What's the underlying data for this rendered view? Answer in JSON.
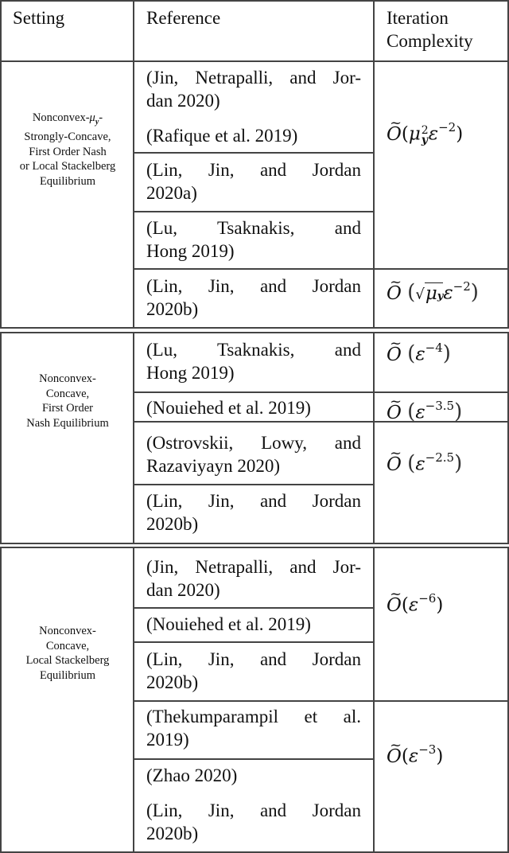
{
  "header": {
    "setting": "Setting",
    "reference": "Reference",
    "complexity_line1": "Iteration",
    "complexity_line2": "Complexity"
  },
  "sections": [
    {
      "setting_lines": [
        "Nonconvex-μ_y-",
        "Strongly-Concave,",
        "First Order Nash",
        "or Local Stackelberg",
        "Equilibrium"
      ],
      "setting_prefix": "Nonconvex-",
      "setting_mu": "μ",
      "setting_mu_sub": "y",
      "setting_rest": [
        "Strongly-Concave,",
        "First Order Nash",
        "or Local Stackelberg",
        "Equilibrium"
      ],
      "references": [
        {
          "line1": "(Jin, Netrapalli, and Jor-",
          "line2": "dan 2020)"
        },
        {
          "line1": "(Rafique et al. 2019)"
        },
        {
          "line1": "(Lin, Jin, and Jordan",
          "line2": "2020a)"
        },
        {
          "line1": "(Lu, Tsaknakis, and",
          "line2": "Hong 2019)"
        },
        {
          "line1": "(Lin, Jin, and Jordan",
          "line2": "2020b)"
        }
      ],
      "complexities": [
        {
          "text": "Õ(μ_y² ε^−2)",
          "base": "O",
          "mu": "μ",
          "mu_sub": "y",
          "mu_sup": "2",
          "eps": "ε",
          "eps_exp": "−2"
        },
        {
          "text": "Õ(√μ_y ε^−2)",
          "base": "O",
          "mu": "μ",
          "mu_sub": "y",
          "eps": "ε",
          "eps_exp": "−2"
        }
      ]
    },
    {
      "setting_lines": [
        "Nonconvex-",
        "Concave,",
        "First Order",
        "Nash Equilibrium"
      ],
      "references": [
        {
          "line1": "(Lu, Tsaknakis, and",
          "line2": "Hong 2019)"
        },
        {
          "line1": "(Nouiehed et al. 2019)"
        },
        {
          "line1": "(Ostrovskii, Lowy, and",
          "line2": "Razaviyayn 2020)"
        },
        {
          "line1": "(Lin, Jin, and Jordan",
          "line2": "2020b)"
        }
      ],
      "complexities": [
        {
          "text": "Õ(ε^−4)",
          "base": "O",
          "eps": "ε",
          "eps_exp": "−4"
        },
        {
          "text": "Õ(ε^−3.5)",
          "base": "O",
          "eps": "ε",
          "eps_exp": "−3.5"
        },
        {
          "text": "Õ(ε^−2.5)",
          "base": "O",
          "eps": "ε",
          "eps_exp": "−2.5"
        }
      ]
    },
    {
      "setting_lines": [
        "Nonconvex-",
        "Concave,",
        "Local Stackelberg",
        "Equilibrium"
      ],
      "references": [
        {
          "line1": "(Jin, Netrapalli, and Jor-",
          "line2": "dan 2020)"
        },
        {
          "line1": "(Nouiehed et al. 2019)"
        },
        {
          "line1": "(Lin, Jin, and Jordan",
          "line2": "2020b)"
        },
        {
          "line1": "(Thekumparampil et al.",
          "line2": "2019)"
        },
        {
          "line1": "(Zhao 2020)"
        },
        {
          "line1": "(Lin, Jin, and Jordan",
          "line2": "2020b)"
        }
      ],
      "complexities": [
        {
          "text": "Õ(ε^−6)",
          "base": "O",
          "eps": "ε",
          "eps_exp": "−6"
        },
        {
          "text": "Õ(ε^−3)",
          "base": "O",
          "eps": "ε",
          "eps_exp": "−3"
        }
      ]
    }
  ]
}
